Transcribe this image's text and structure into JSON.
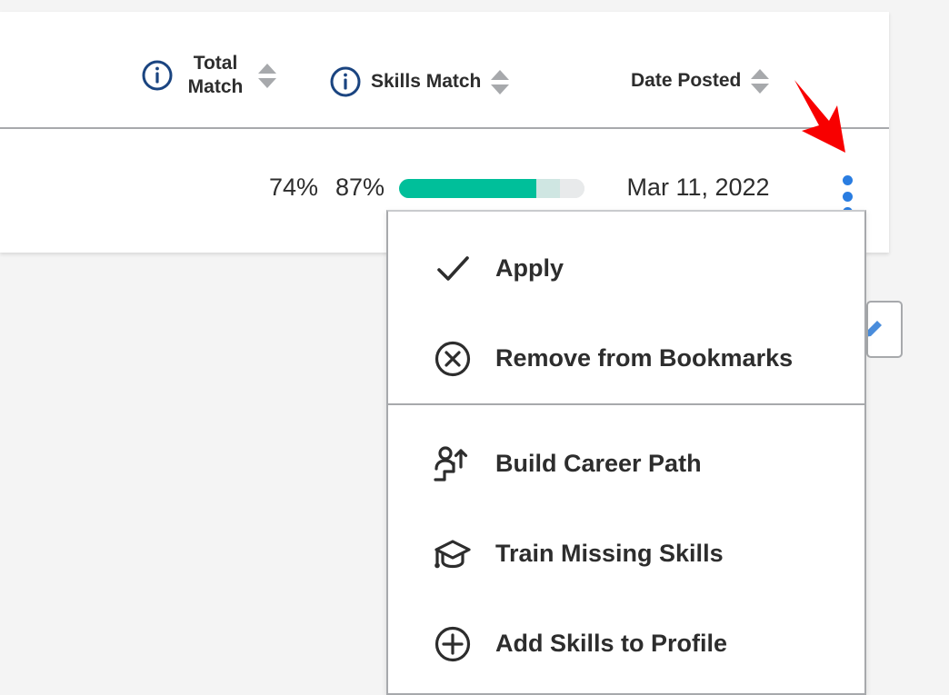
{
  "table": {
    "columns": [
      {
        "id": "total-match",
        "label": "Total Match",
        "info_icon": "info-icon",
        "sortable": true
      },
      {
        "id": "skills-match",
        "label": "Skills Match",
        "info_icon": "info-icon",
        "sortable": true
      },
      {
        "id": "date-posted",
        "label": "Date Posted",
        "info_icon": null,
        "sortable": true
      }
    ],
    "row": {
      "total_match": "74%",
      "skills_match": "87%",
      "skills_bar": {
        "primary_pct": 74,
        "secondary_pct": 13,
        "empty_pct": 13
      },
      "date_posted": "Mar 11, 2022",
      "actions_trigger": "three-dot-menu"
    }
  },
  "dropdown": {
    "groups": [
      {
        "id": "group-top",
        "items": [
          {
            "id": "apply",
            "label": "Apply",
            "icon": "check-icon"
          },
          {
            "id": "remove",
            "label": "Remove from Bookmarks",
            "icon": "circle-x-icon"
          }
        ]
      },
      {
        "id": "group-bottom",
        "items": [
          {
            "id": "build-career-path",
            "label": "Build Career Path",
            "icon": "person-stairs-arrow-icon"
          },
          {
            "id": "train-skills",
            "label": "Train Missing Skills",
            "icon": "graduation-cap-icon"
          },
          {
            "id": "add-skills",
            "label": "Add Skills to Profile",
            "icon": "plus-circle-icon"
          }
        ]
      }
    ]
  },
  "annotation": {
    "arrow": "red-arrow-pointing-to-three-dot-menu",
    "color": "#f80000"
  },
  "side_chip": {
    "icon": "pencil-icon"
  },
  "colors": {
    "info_icon": "#1a4480",
    "kebab_dot": "#2a7de1",
    "bar_primary": "#00bf9a",
    "bar_secondary": "#cfe6e2",
    "bar_empty": "#e8eaeb",
    "text": "#2d2d2d",
    "rule": "#a7a9ac",
    "page_bg": "#f4f4f4",
    "card_bg": "#ffffff",
    "annotation": "#f80000"
  }
}
